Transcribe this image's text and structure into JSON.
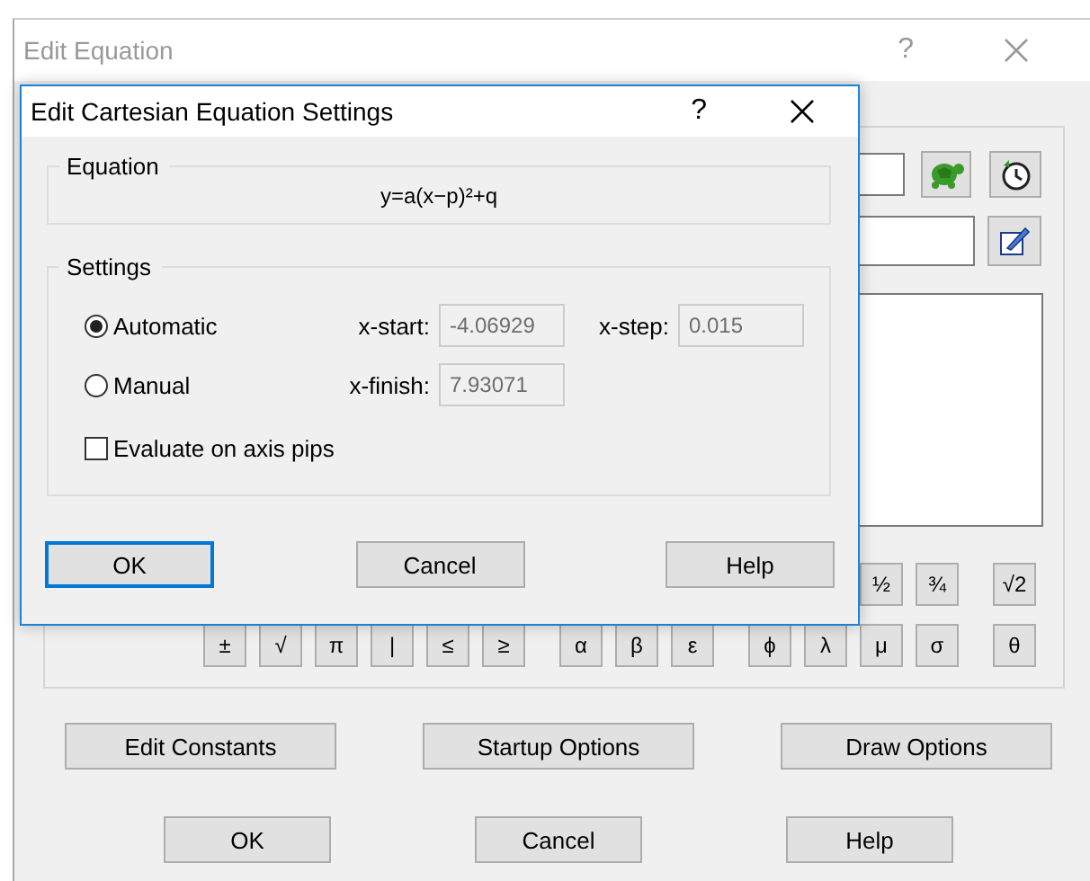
{
  "window": {
    "title": "Edit Equation",
    "help_glyph": "?"
  },
  "symbols_row_1": [
    [
      "½",
      "¾"
    ],
    [
      "√2"
    ]
  ],
  "symbols_row_2": [
    [
      "±",
      "√",
      "π",
      "|",
      "≤",
      "≥"
    ],
    [
      "α",
      "β",
      "ε"
    ],
    [
      "ϕ",
      "λ",
      "μ",
      "σ"
    ],
    [
      "θ"
    ]
  ],
  "option_buttons": [
    "Edit Constants",
    "Startup Options",
    "Draw Options"
  ],
  "buttons": [
    {
      "label": "OK"
    },
    {
      "label": "Cancel"
    },
    {
      "label": "Help"
    }
  ],
  "dialog": {
    "title": "Edit Cartesian Equation Settings",
    "help_glyph": "?",
    "equation_group": {
      "label": "Equation",
      "equation": "y=a(x−p)²+q"
    },
    "settings_group": {
      "label": "Settings",
      "modes": [
        {
          "label": "Automatic",
          "selected": true
        },
        {
          "label": "Manual",
          "selected": false
        }
      ],
      "fields": [
        {
          "label": "x-start:",
          "value": "-4.06929",
          "disabled": true
        },
        {
          "label": "x-step:",
          "value": "0.015",
          "disabled": true
        },
        {
          "label": "x-finish:",
          "value": "7.93071",
          "disabled": true
        }
      ],
      "evaluate_on_axis_pips": {
        "label": "Evaluate on axis pips",
        "checked": false
      }
    },
    "buttons": [
      {
        "label": "OK",
        "default": true
      },
      {
        "label": "Cancel",
        "default": false
      },
      {
        "label": "Help",
        "default": false
      }
    ]
  }
}
